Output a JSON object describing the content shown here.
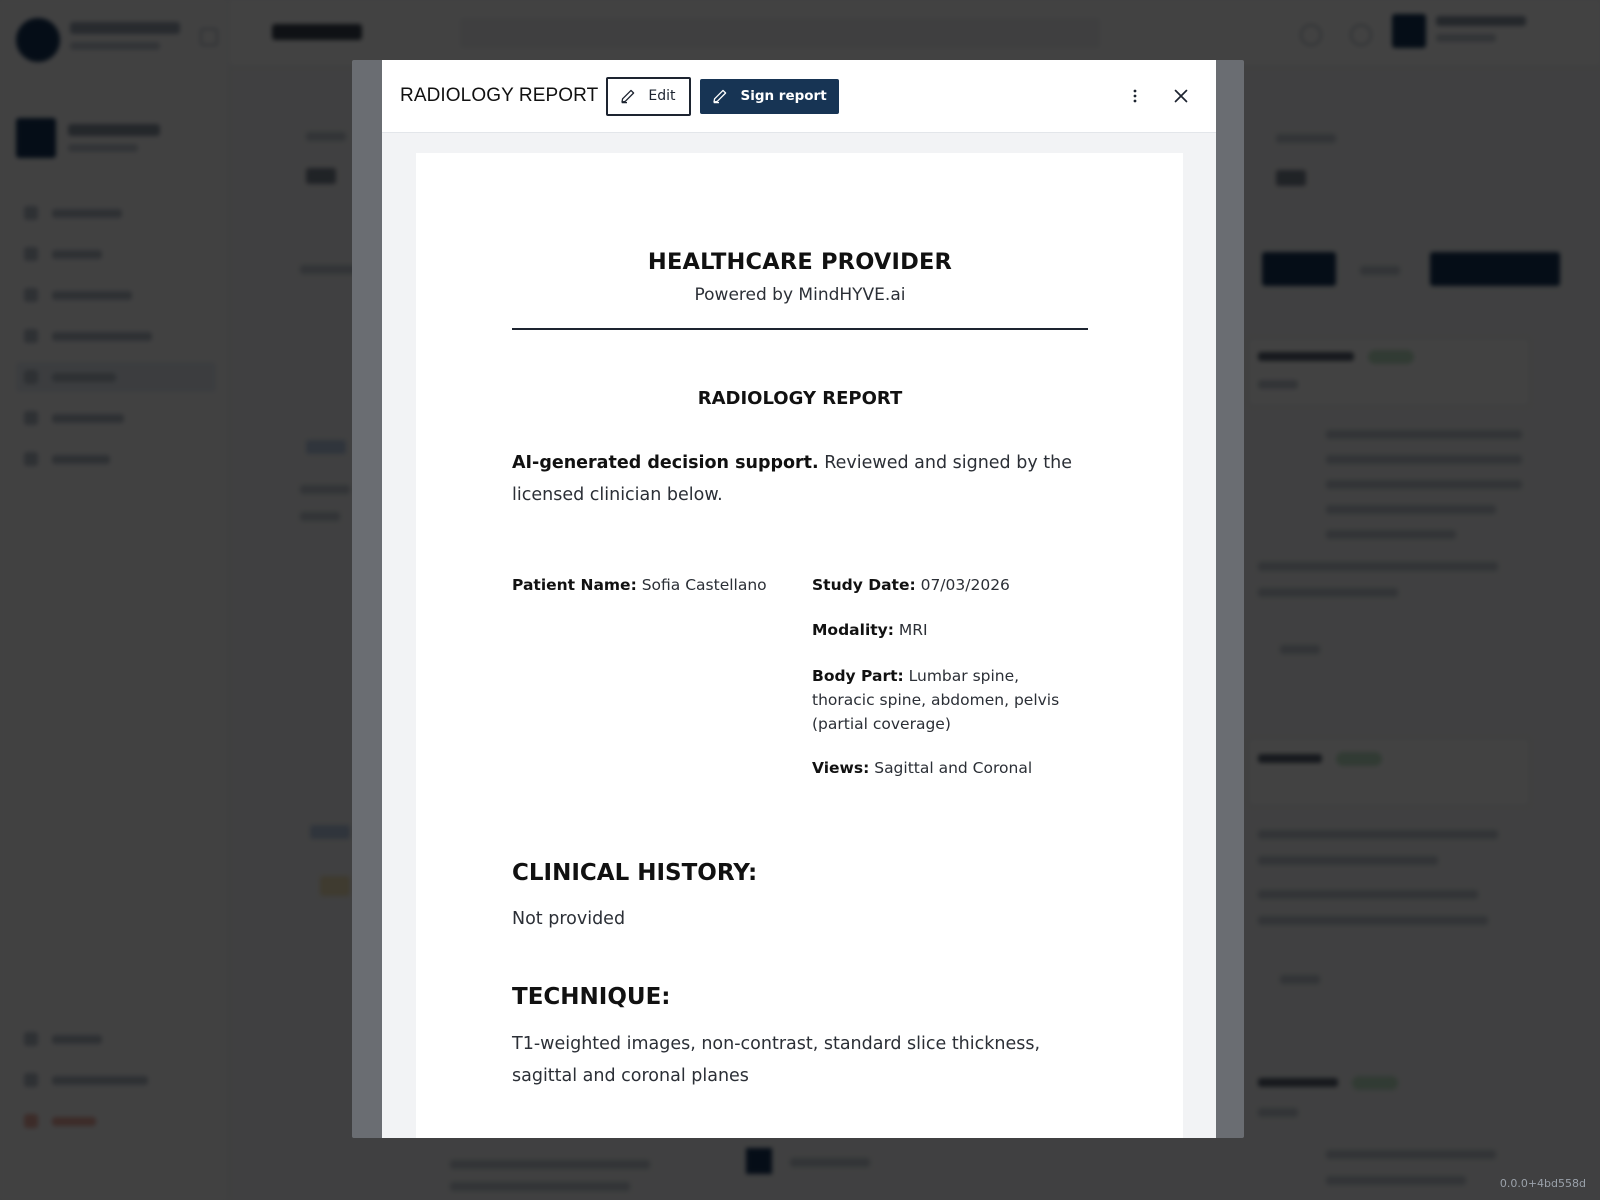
{
  "modal": {
    "title": "RADIOLOGY REPORT",
    "edit_label": "Edit",
    "sign_label": "Sign report"
  },
  "report": {
    "org_name": "HEALTHCARE PROVIDER",
    "org_tagline": "Powered by MindHYVE.ai",
    "title": "RADIOLOGY REPORT",
    "disclaimer_bold": "AI-generated decision support.",
    "disclaimer_text": " Reviewed and signed by the licensed clinician below.",
    "patient_name_label": "Patient Name:",
    "patient_name": " Sofia Castellano",
    "study_date_label": "Study Date:",
    "study_date": " 07/03/2026",
    "modality_label": "Modality:",
    "modality": " MRI",
    "body_part_label": "Body Part:",
    "body_part": " Lumbar spine, thoracic spine, abdomen, pelvis (partial coverage)",
    "views_label": "Views:",
    "views": " Sagittal and Coronal",
    "clinical_history_heading": "CLINICAL HISTORY:",
    "clinical_history": "Not provided",
    "technique_heading": "TECHNIQUE:",
    "technique": "T1-weighted images, non-contrast, standard slice thickness, sagittal and coronal planes"
  },
  "version": "0.0.0+4bd558d",
  "icons": {
    "edit": "pencil-icon",
    "sign": "pencil-icon",
    "more": "more-vertical-icon",
    "close": "close-icon"
  },
  "colors": {
    "primary": "#173454",
    "overlay": "rgba(0,0,0,0.74)",
    "text": "#111111"
  }
}
